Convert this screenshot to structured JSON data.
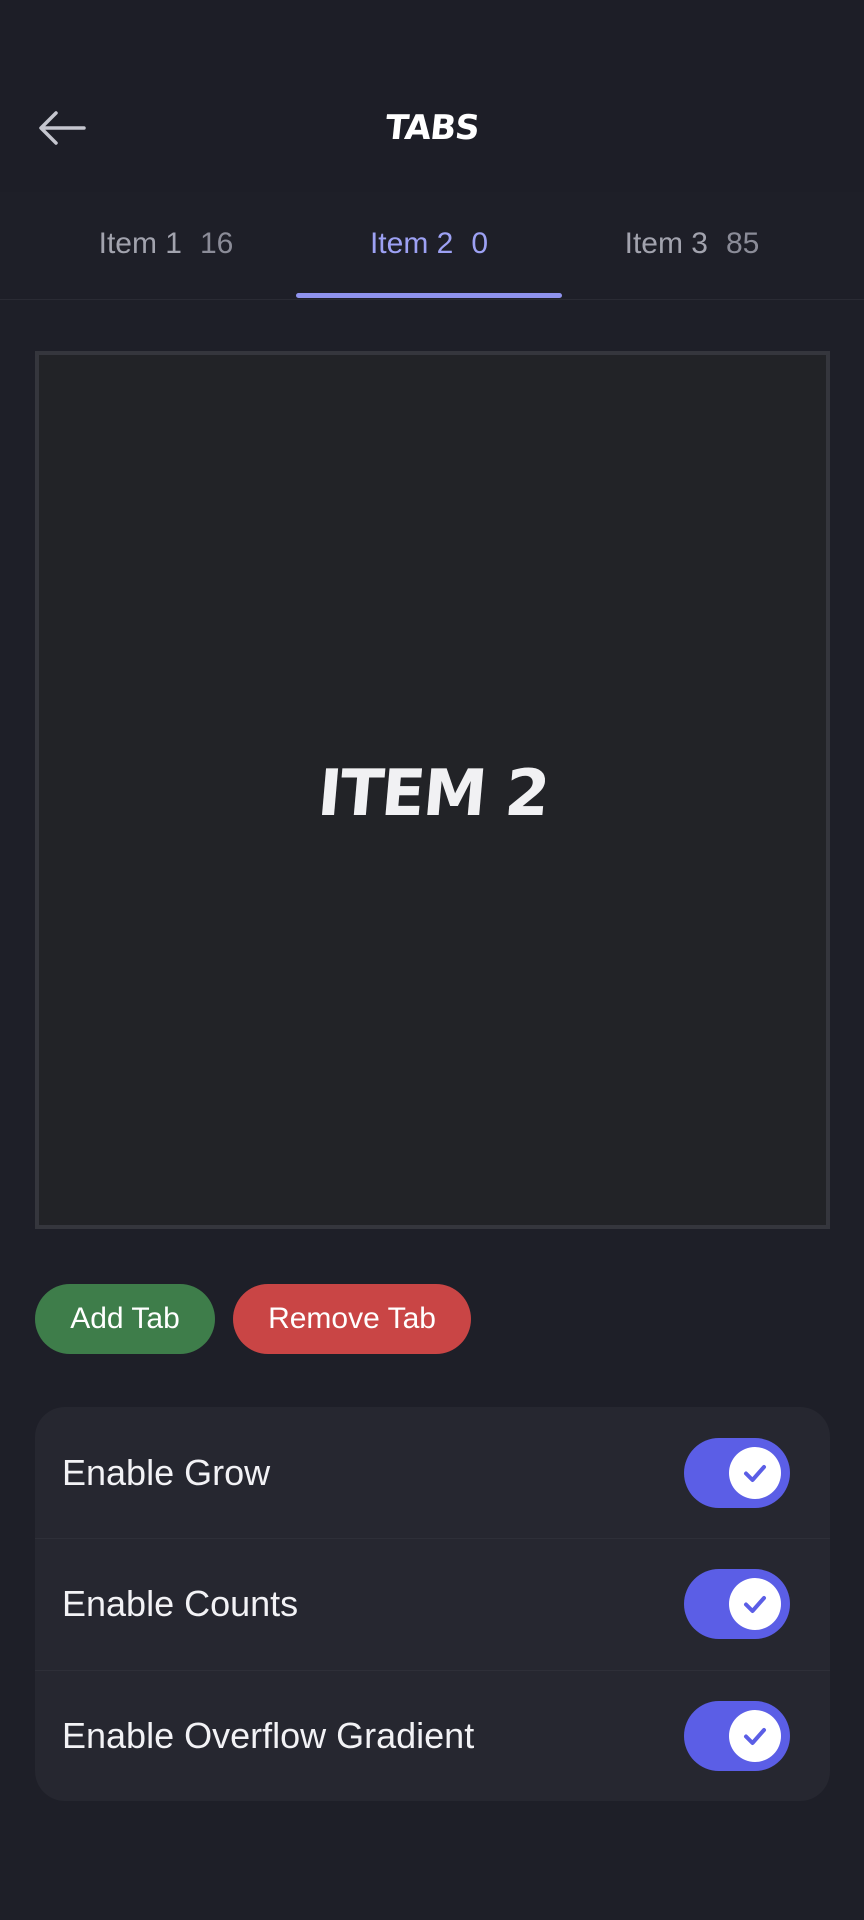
{
  "header": {
    "title": "TABS",
    "back_icon": "arrow-left-icon"
  },
  "tabs": [
    {
      "label": "Item 1",
      "count": "16",
      "active": false
    },
    {
      "label": "Item 2",
      "count": "0",
      "active": true
    },
    {
      "label": "Item 3",
      "count": "85",
      "active": false
    }
  ],
  "content": {
    "label": "ITEM 2"
  },
  "actions": {
    "add_label": "Add Tab",
    "remove_label": "Remove Tab"
  },
  "settings": [
    {
      "label": "Enable Grow",
      "enabled": true,
      "icon": "check-icon"
    },
    {
      "label": "Enable Counts",
      "enabled": true,
      "icon": "check-icon"
    },
    {
      "label": "Enable Overflow Gradient",
      "enabled": true,
      "icon": "check-icon"
    }
  ],
  "colors": {
    "background": "#1e1f28",
    "accent": "#5b5ee6",
    "tab_active": "#9da1f4",
    "add_button": "#3e7d4a",
    "remove_button": "#c94545"
  }
}
